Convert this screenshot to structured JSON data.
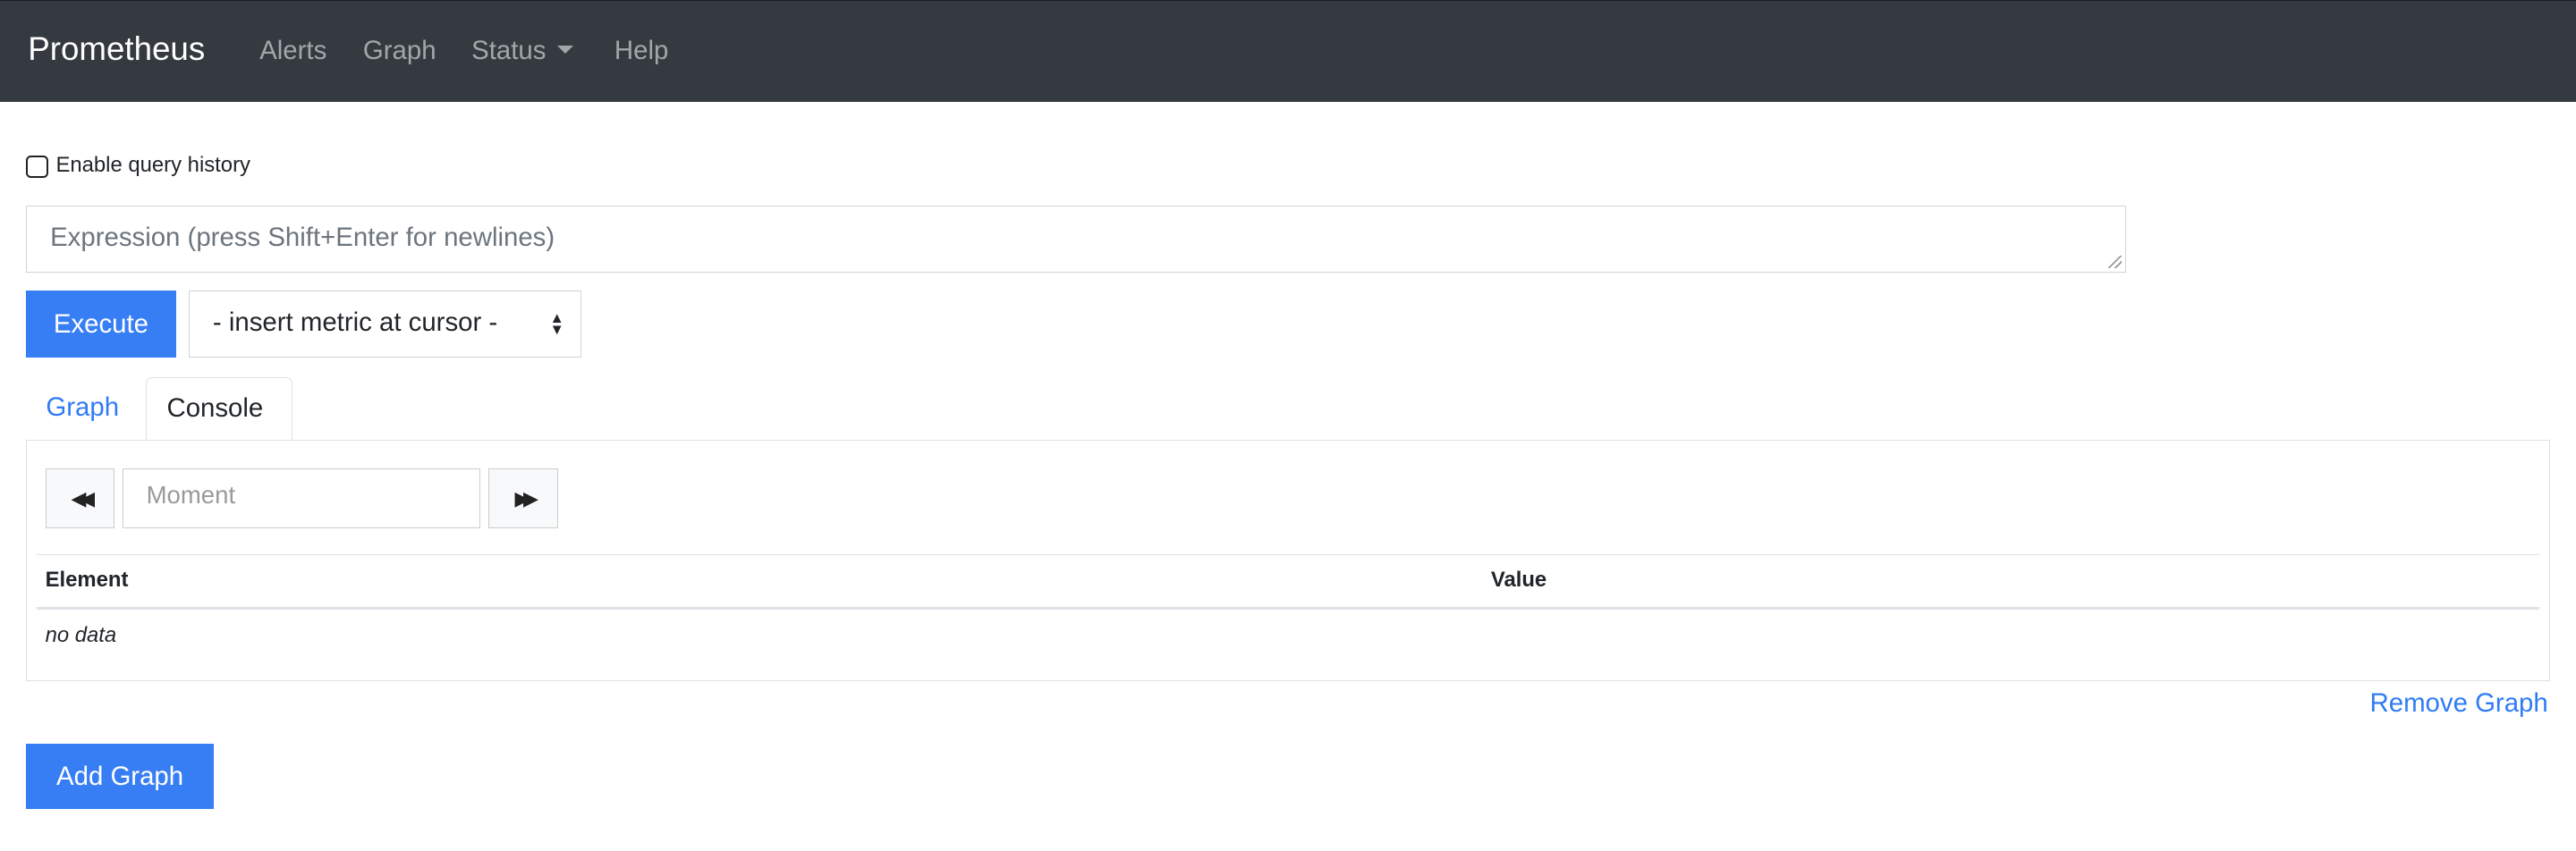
{
  "navbar": {
    "brand": "Prometheus",
    "links": [
      "Alerts",
      "Graph",
      "Status",
      "Help"
    ]
  },
  "query_history": {
    "label": "Enable query history",
    "checked": false
  },
  "expression": {
    "placeholder": "Expression (press Shift+Enter for newlines)",
    "value": ""
  },
  "execute_label": "Execute",
  "metric_select": {
    "selected": "- insert metric at cursor -"
  },
  "tabs": [
    {
      "label": "Graph",
      "active": false
    },
    {
      "label": "Console",
      "active": true
    }
  ],
  "console": {
    "moment_placeholder": "Moment",
    "columns": [
      "Element",
      "Value"
    ],
    "empty_text": "no data"
  },
  "remove_graph_label": "Remove Graph",
  "add_graph_label": "Add Graph",
  "colors": {
    "navbar": "#343a40",
    "primary": "#377ef5"
  }
}
